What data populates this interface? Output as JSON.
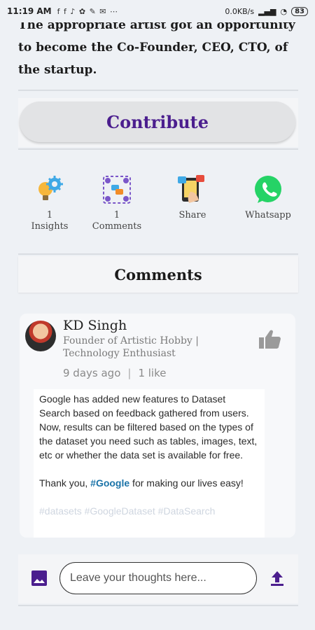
{
  "status_bar": {
    "time": "11:19 AM",
    "notif_icons": "f f ♪ ✿ ✎ ✉ ⋯",
    "network": "0.0KB/s",
    "battery": "83"
  },
  "intro": {
    "text": "The appropriate artist got an opportunity to become the Co-Founder, CEO, CTO, of the startup."
  },
  "contribute": {
    "label": "Contribute"
  },
  "actions": [
    {
      "count": "1",
      "label": "Insights",
      "icon": "lightbulb-gear-icon"
    },
    {
      "count": "1",
      "label": "Comments",
      "icon": "people-chat-icon"
    },
    {
      "count": "",
      "label": "Share",
      "icon": "share-phone-icon"
    },
    {
      "count": "",
      "label": "Whatsapp",
      "icon": "whatsapp-icon"
    }
  ],
  "comments_section": {
    "title": "Comments"
  },
  "comment": {
    "author": "KD Singh",
    "role": "Founder of Artistic Hobby | Technology Enthusiast",
    "time": "9 days ago",
    "likes": "1 like",
    "body_p1": "Google has added new features to Dataset Search based on feedback gathered from users. Now, results can be filtered based on the types of the dataset you need such as tables, images, text, etc or whether the data set is available for free.",
    "body_p2_prefix": "Thank you, ",
    "hashtag": "#Google",
    "body_p2_suffix": " for making our lives easy!",
    "faded_tags": "#datasets #GoogleDataset #DataSearch"
  },
  "composer": {
    "placeholder": "Leave your thoughts here...",
    "icons": [
      "image-icon",
      "upload-icon"
    ]
  },
  "colors": {
    "accent_purple": "#4b1e8e",
    "whatsapp_green": "#25d366",
    "hashtag_blue": "#1a73a8",
    "background": "#eef1f5"
  }
}
